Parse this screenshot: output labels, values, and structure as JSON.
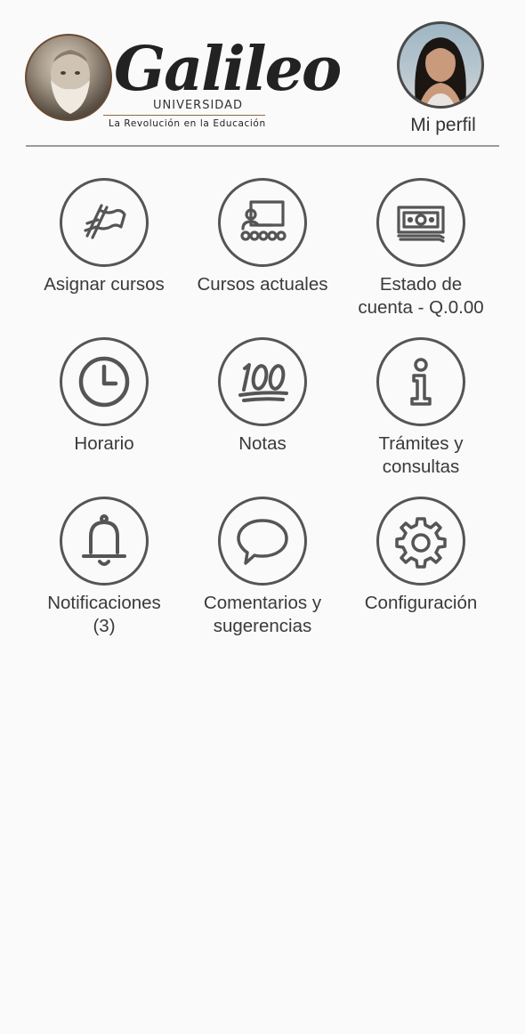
{
  "header": {
    "logo": {
      "wordmark": "Galileo",
      "subtitle": "UNIVERSIDAD",
      "tagline": "La Revolución en la Educación"
    },
    "profile_label": "Mi perfil"
  },
  "menu": [
    {
      "label": "Asignar cursos",
      "icon": "flag-icon"
    },
    {
      "label": "Cursos actuales",
      "icon": "classroom-icon"
    },
    {
      "label": "Estado de\ncuenta - Q.0.00",
      "icon": "banknote-icon"
    },
    {
      "label": "Horario",
      "icon": "clock-icon"
    },
    {
      "label": "Notas",
      "icon": "hundred-points-icon"
    },
    {
      "label": "Trámites y\nconsultas",
      "icon": "info-icon"
    },
    {
      "label": "Notificaciones\n(3)",
      "icon": "bell-icon"
    },
    {
      "label": "Comentarios y\nsugerencias",
      "icon": "speech-bubble-icon"
    },
    {
      "label": "Configuración",
      "icon": "gear-icon"
    }
  ],
  "colors": {
    "background": "#fafafa",
    "icon_stroke": "#555555",
    "text": "#3a3a3a"
  }
}
